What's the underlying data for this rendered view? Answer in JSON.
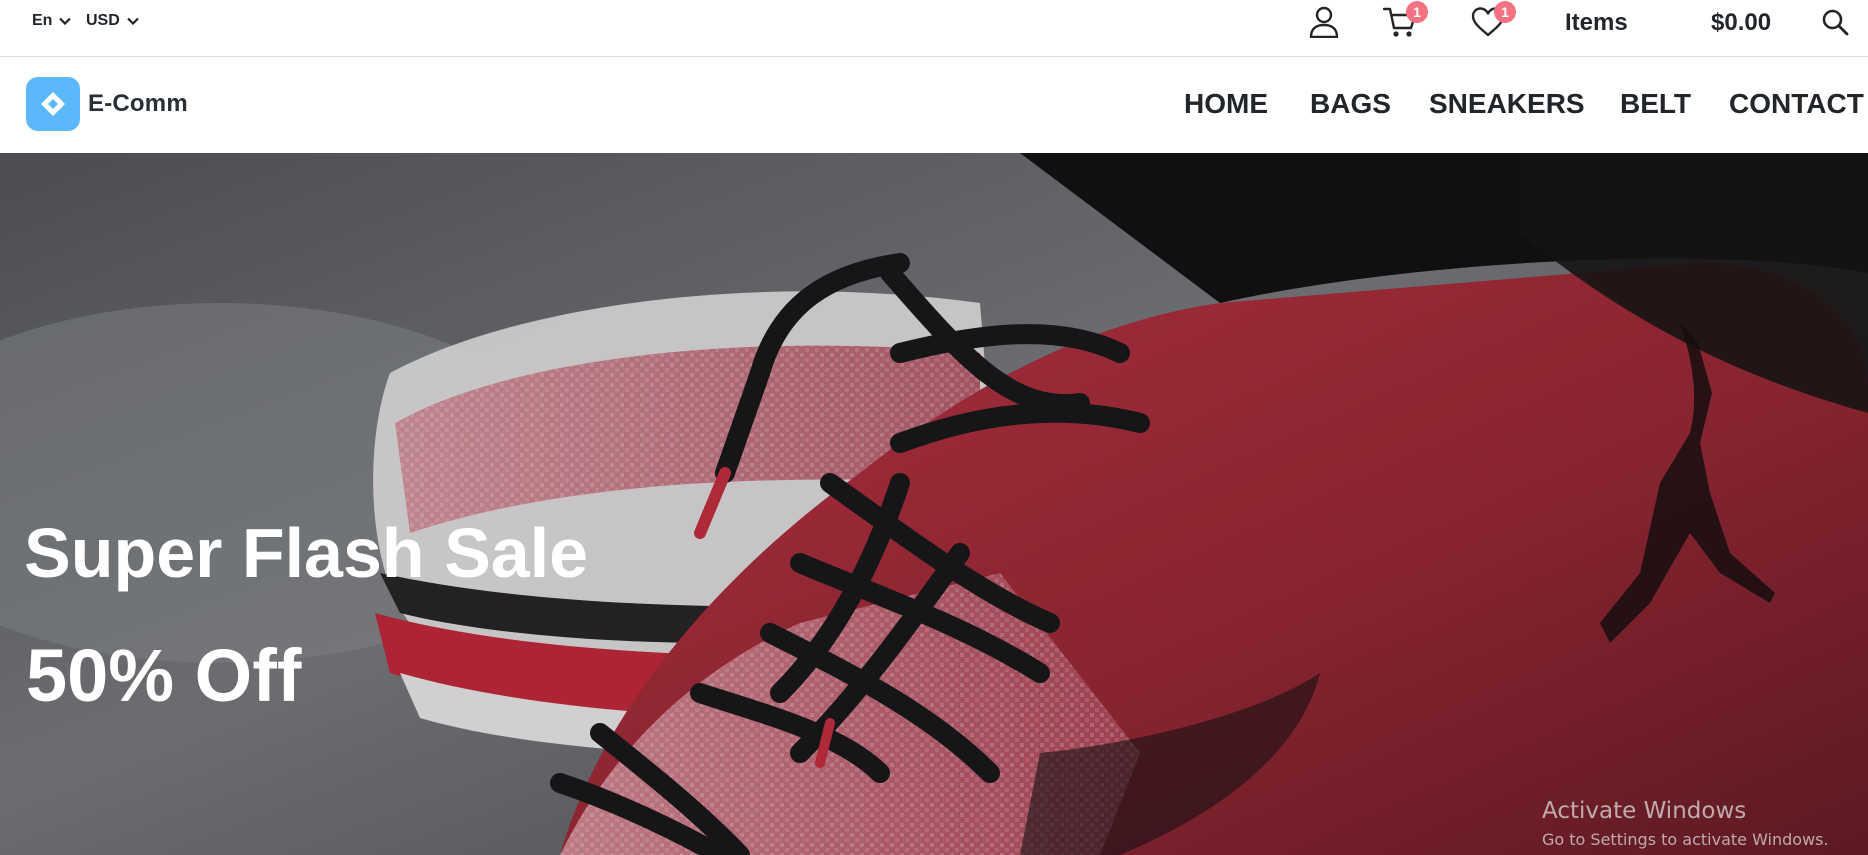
{
  "topbar": {
    "language": {
      "selected": "En",
      "icon": "chevron-down-icon"
    },
    "currency": {
      "selected": "USD",
      "icon": "chevron-down-icon"
    },
    "account": {
      "icon": "user-icon"
    },
    "cart": {
      "icon": "cart-icon",
      "count": "1"
    },
    "wishlist": {
      "icon": "heart-icon",
      "count": "1"
    },
    "items_label": "Items",
    "cart_total": "$0.00",
    "search": {
      "icon": "search-icon"
    }
  },
  "header": {
    "logo": {
      "text": "E-Comm",
      "icon": "diamond-logo-icon"
    },
    "nav": [
      {
        "label": "HOME"
      },
      {
        "label": "BAGS"
      },
      {
        "label": "SNEAKERS"
      },
      {
        "label": "BELT"
      },
      {
        "label": "CONTACT"
      }
    ]
  },
  "hero": {
    "title": "Super Flash Sale",
    "subtitle": "50% Off"
  },
  "watermark": {
    "line1": "Activate Windows",
    "line2": "Go to Settings to activate Windows."
  },
  "colors": {
    "accent_logo": "#5cb8f8",
    "badge": "#f47383",
    "text_dark": "#22262a",
    "hero_text": "#ffffff"
  }
}
